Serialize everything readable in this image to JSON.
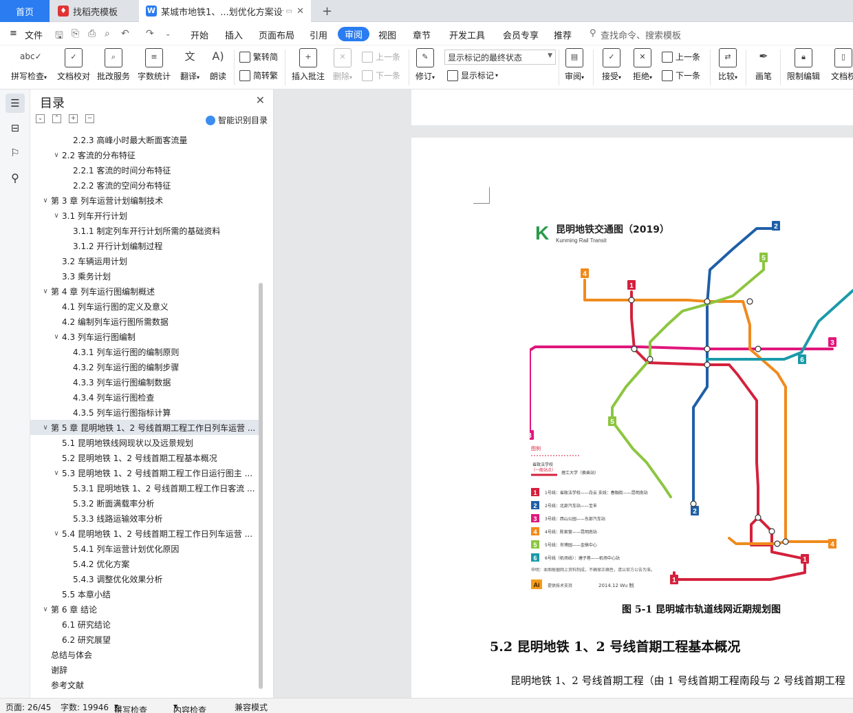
{
  "tabs": {
    "home": "首页",
    "template": "找稻壳模板",
    "doc": "某城市地铁1、...划优化方案设计",
    "add": "+"
  },
  "menu": {
    "file": "文件",
    "items": [
      "开始",
      "插入",
      "页面布局",
      "引用",
      "审阅",
      "视图",
      "章节",
      "开发工具",
      "会员专享",
      "推荐"
    ],
    "search": "查找命令、搜索模板"
  },
  "ribbon": {
    "spell": "拼写检查",
    "doccheck": "文档校对",
    "revise": "批改服务",
    "wordcount": "字数统计",
    "translate": "翻译",
    "read": "朗读",
    "t2s": "繁转简",
    "s2t": "简转繁",
    "insert_comment": "插入批注",
    "delete": "删除",
    "prev": "上一条",
    "next": "下一条",
    "track": "修订",
    "show_state": "显示标记的最终状态",
    "show_marks": "显示标记",
    "review": "审阅",
    "accept": "接受",
    "reject": "拒绝",
    "prev2": "上一条",
    "next2": "下一条",
    "compare": "比较",
    "ink": "画笔",
    "restrict": "限制编辑",
    "docperm": "文档权"
  },
  "nav": {
    "title": "目录",
    "smart": "智能识别目录",
    "toc": [
      {
        "label": "2.2.3 高峰小时最大断面客流量",
        "level": 3,
        "chev": ""
      },
      {
        "label": "2.2 客流的分布特征",
        "level": 2,
        "chev": "∨"
      },
      {
        "label": "2.2.1 客流的时间分布特征",
        "level": 3,
        "chev": ""
      },
      {
        "label": "2.2.2 客流的空间分布特征",
        "level": 3,
        "chev": ""
      },
      {
        "label": "第 3 章  列车运营计划编制技术",
        "level": 1,
        "chev": "∨"
      },
      {
        "label": "3.1 列车开行计划",
        "level": 2,
        "chev": "∨"
      },
      {
        "label": "3.1.1 制定列车开行计划所需的基础资料",
        "level": 3,
        "chev": ""
      },
      {
        "label": "3.1.2 开行计划编制过程",
        "level": 3,
        "chev": ""
      },
      {
        "label": "3.2 车辆运用计划",
        "level": 2,
        "chev": ""
      },
      {
        "label": "3.3 乘务计划",
        "level": 2,
        "chev": ""
      },
      {
        "label": "第 4 章  列车运行图编制概述",
        "level": 1,
        "chev": "∨"
      },
      {
        "label": "4.1 列车运行图的定义及意义",
        "level": 2,
        "chev": ""
      },
      {
        "label": "4.2 编制列车运行图所需数据",
        "level": 2,
        "chev": ""
      },
      {
        "label": "4.3 列车运行图编制",
        "level": 2,
        "chev": "∨"
      },
      {
        "label": "4.3.1 列车运行图的编制原则",
        "level": 3,
        "chev": ""
      },
      {
        "label": "4.3.2 列车运行图的编制步骤",
        "level": 3,
        "chev": ""
      },
      {
        "label": "4.3.3 列车运行图编制数据",
        "level": 3,
        "chev": ""
      },
      {
        "label": "4.3.4 列车运行图检查",
        "level": 3,
        "chev": ""
      },
      {
        "label": "4.3.5 列车运行图指标计算",
        "level": 3,
        "chev": ""
      },
      {
        "label": "第 5 章  昆明地铁 1、2 号线首期工程工作日列车运营 ...",
        "level": 1,
        "chev": "∨",
        "selected": true
      },
      {
        "label": "5.1 昆明地铁线网现状以及远景规划",
        "level": 2,
        "chev": ""
      },
      {
        "label": "5.2 昆明地铁 1、2 号线首期工程基本概况",
        "level": 2,
        "chev": ""
      },
      {
        "label": "5.3 昆明地铁 1、2 号线首期工程工作日运行图主 ...",
        "level": 2,
        "chev": "∨"
      },
      {
        "label": "5.3.1 昆明地铁 1、2 号线首期工程工作日客流 ...",
        "level": 3,
        "chev": ""
      },
      {
        "label": "5.3.2 断面满载率分析",
        "level": 3,
        "chev": ""
      },
      {
        "label": "5.3.3 线路运输效率分析",
        "level": 3,
        "chev": ""
      },
      {
        "label": "5.4 昆明地铁 1、2 号线首期工程工作日列车运营 ...",
        "level": 2,
        "chev": "∨"
      },
      {
        "label": "5.4.1 列车运营计划优化原因",
        "level": 3,
        "chev": ""
      },
      {
        "label": "5.4.2 优化方案",
        "level": 3,
        "chev": ""
      },
      {
        "label": "5.4.3 调整优化效果分析",
        "level": 3,
        "chev": ""
      },
      {
        "label": "5.5 本章小结",
        "level": 2,
        "chev": ""
      },
      {
        "label": "第 6 章  结论",
        "level": 1,
        "chev": "∨"
      },
      {
        "label": "6.1 研究结论",
        "level": 2,
        "chev": ""
      },
      {
        "label": "6.2 研究展望",
        "level": 2,
        "chev": ""
      },
      {
        "label": "总结与体会",
        "level": 1,
        "chev": ""
      },
      {
        "label": "谢辞",
        "level": 1,
        "chev": ""
      },
      {
        "label": "参考文献",
        "level": 1,
        "chev": ""
      }
    ]
  },
  "doc": {
    "map_title": "昆明地铁交通图（2019）",
    "map_subtitle": "Kunming Rail Transit",
    "legend_title": "图例",
    "legend_items": [
      {
        "num": "1",
        "color": "#d4213d",
        "text": "1号线：省政法学校——白云  支线：春融街——昆明南站"
      },
      {
        "num": "2",
        "color": "#1f5fa8",
        "text": "2号线：北部汽车站——宝丰"
      },
      {
        "num": "3",
        "color": "#e0177c",
        "text": "3号线：西山公园——东部汽车站"
      },
      {
        "num": "4",
        "color": "#f08a1c",
        "text": "4号线：陈家营——昆明南站"
      },
      {
        "num": "5",
        "color": "#8cc63f",
        "text": "5号线：世博园——金鼎中心"
      },
      {
        "num": "6",
        "color": "#1b9aaa",
        "text": "6号线（机场线）：塘子巷——机场中心站"
      }
    ],
    "legend_note": "申明：本图根据网上资料制成，不确保正确性，请以官方公告为准。",
    "legend_station1": "省政法学校",
    "legend_station1_note": "（一般站点）",
    "legend_station2": "理工大学（换乘站）",
    "credit": "提供技术支持",
    "credit_date": "2014.12  Wu 制",
    "caption": "图 5-1  昆明城市轨道线网近期规划图",
    "heading": "5.2 昆明地铁 1、2 号线首期工程基本概况",
    "para": "昆明地铁 1、2 号线首期工程（由 1 号线首期工程南段与 2 号线首期工程"
  },
  "status": {
    "page": "页面: 26/45",
    "words": "字数: 19946",
    "spell": "拼写检查",
    "content": "内容检查",
    "compat": "兼容模式"
  },
  "colors": {
    "accent": "#2a7cf0",
    "line1": "#d4213d",
    "line2": "#1f5fa8",
    "line3": "#e0177c",
    "line4": "#f08a1c",
    "line5": "#8cc63f",
    "line6": "#1b9aaa"
  }
}
